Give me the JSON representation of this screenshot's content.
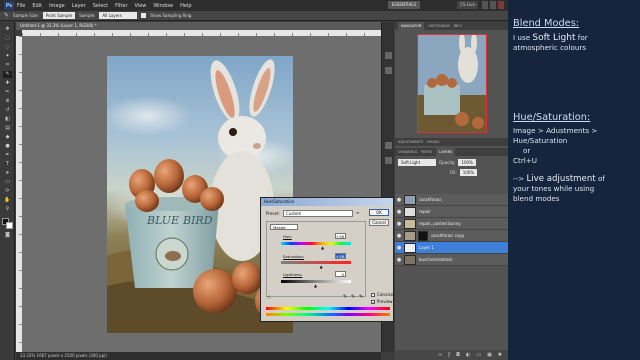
{
  "menubar": {
    "logo": "Ps",
    "items": [
      "File",
      "Edit",
      "Image",
      "Layer",
      "Select",
      "Filter",
      "View",
      "Window",
      "Help"
    ],
    "workspace": "ESSENTIALS",
    "cs_live": "CS Live"
  },
  "options": {
    "sample_size_label": "Sample Size:",
    "sample_size_value": "Point Sample",
    "sample_label": "Sample:",
    "sample_value": "All Layers",
    "show_ring_label": "Show Sampling Ring"
  },
  "document": {
    "tab_title": "Untitled-1 @ 33.3% (Layer 1, RGB/8) *",
    "status": "33.33%  1667 pixels x 2500 pixels (300 ppi)"
  },
  "panels": {
    "top_tabs": [
      "NAVIGATOR",
      "HISTOGRAM",
      "INFO"
    ],
    "mid_tabs": [
      "ADJUSTMENTS",
      "MASKS"
    ],
    "layers_tabs": [
      "LAYERS",
      "CHANNELS",
      "PATHS"
    ],
    "blend_mode": "Soft Light",
    "opacity_label": "Opacity:",
    "opacity_value": "100%",
    "fill_label": "Fill:",
    "fill_value": "100%",
    "layers": [
      {
        "name": "sarahforaci",
        "type": "photo",
        "selected": false
      },
      {
        "name": "repair",
        "type": "plain",
        "selected": false
      },
      {
        "name": "repair, pasted bunny",
        "type": "photo",
        "selected": false
      },
      {
        "name": "sarahforaci copy",
        "type": "masked",
        "selected": false
      },
      {
        "name": "Layer 1",
        "type": "plain",
        "selected": true
      },
      {
        "name": "buschelmelstock",
        "type": "photo",
        "selected": false
      }
    ]
  },
  "dialog": {
    "title": "Hue/Saturation",
    "preset_label": "Preset:",
    "preset_value": "Custom",
    "channel_value": "Master",
    "hue_label": "Hue:",
    "hue_value": "+36",
    "hue_fraction": 0.6,
    "saturation_label": "Saturation:",
    "saturation_value": "+16",
    "saturation_fraction": 0.58,
    "lightness_label": "Lightness:",
    "lightness_value": "0",
    "lightness_fraction": 0.5,
    "ok_label": "OK",
    "cancel_label": "Cancel",
    "colorize_label": "Colorize",
    "preview_label": "Preview"
  },
  "photo": {
    "bucket_text_1": "BLUE",
    "bucket_text_2": "BIRD"
  },
  "annotation": {
    "blend_heading": "Blend Modes:",
    "blend_line_prefix": "I use ",
    "blend_highlight": "Soft Light",
    "blend_line_suffix": " for",
    "blend_line2": "atmospheric colours",
    "hue_heading": "Hue/Saturation:",
    "hue_line1": "Image > Adustments >",
    "hue_line2": "Hue/Saturation",
    "hue_or": "or",
    "hue_shortcut": "Ctrl+U",
    "live_prefix": "--> ",
    "live_highlight": "Live adjustment",
    "live_suffix": " of",
    "live_line2": "your tones while using",
    "live_line3": "blend modes"
  },
  "colors": {
    "annotation_bg": "#16243d",
    "selected_layer": "#3e7fd9",
    "dialog_bg": "#d4d0c8"
  }
}
